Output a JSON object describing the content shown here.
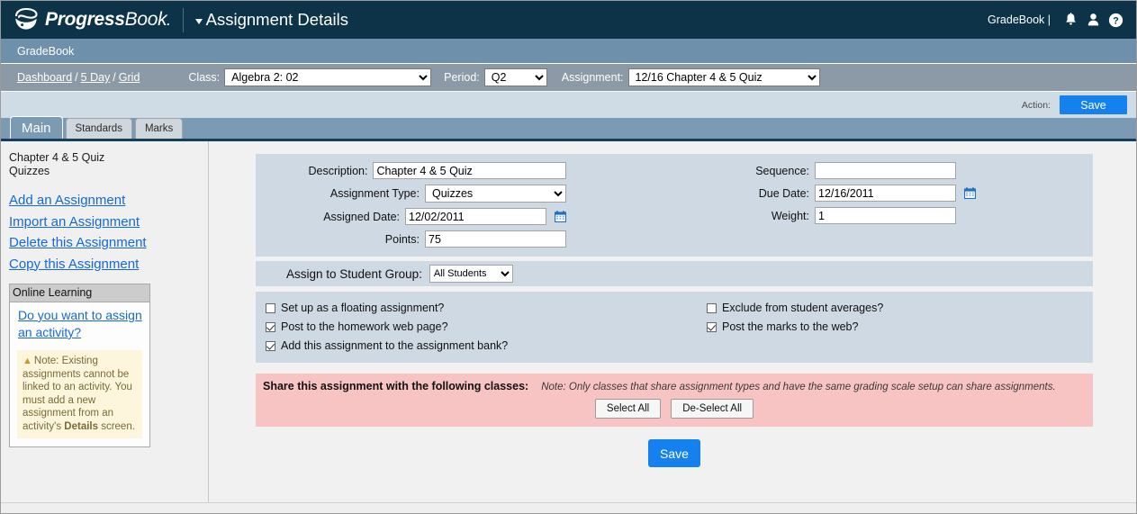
{
  "header": {
    "brand_primary": "Progress",
    "brand_secondary": "Book",
    "brand_dot": ".",
    "page_title": "Assignment Details",
    "user_label": "GradeBook |",
    "icons": {
      "notifications": "bell-icon",
      "account": "user-icon",
      "help": "help-icon"
    },
    "colors": {
      "topbar": "#0d3349",
      "accent": "#1581ef"
    }
  },
  "module_strip": {
    "label": "GradeBook"
  },
  "filter_bar": {
    "breadcrumbs": [
      {
        "label": "Dashboard"
      },
      {
        "label": "5 Day"
      },
      {
        "label": "Grid"
      }
    ],
    "breadcrumb_separator": "/",
    "class": {
      "label": "Class:",
      "value": "Algebra 2: 02"
    },
    "period": {
      "label": "Period:",
      "value": "Q2"
    },
    "assignment": {
      "label": "Assignment:",
      "value": "12/16 Chapter 4 & 5 Quiz"
    }
  },
  "action_bar": {
    "label": "Action:",
    "save_label": "Save"
  },
  "tabs": [
    {
      "label": "Main",
      "active": true
    },
    {
      "label": "Standards",
      "active": false
    },
    {
      "label": "Marks",
      "active": false
    }
  ],
  "sidebar": {
    "assignment_name": "Chapter 4 & 5 Quiz",
    "assignment_type": "Quizzes",
    "links": [
      {
        "label": "Add an Assignment"
      },
      {
        "label": "Import an Assignment"
      },
      {
        "label": "Delete this Assignment"
      },
      {
        "label": "Copy this Assignment"
      }
    ],
    "online_learning": {
      "header": "Online Learning",
      "link": "Do you want to assign an activity?",
      "note_prefix": "Note: Existing assignments cannot be linked to an activity. You must add a new assignment from an activity's ",
      "note_bold": "Details",
      "note_suffix": " screen."
    }
  },
  "form": {
    "description": {
      "label": "Description:",
      "value": "Chapter 4 & 5 Quiz"
    },
    "assignment_type": {
      "label": "Assignment Type:",
      "value": "Quizzes"
    },
    "assigned_date": {
      "label": "Assigned Date:",
      "value": "12/02/2011"
    },
    "points": {
      "label": "Points:",
      "value": "75"
    },
    "sequence": {
      "label": "Sequence:",
      "value": "",
      "placeholder": ""
    },
    "due_date": {
      "label": "Due Date:",
      "value": "12/16/2011"
    },
    "weight": {
      "label": "Weight:",
      "value": "1"
    },
    "calendar_icon": "calendar-icon"
  },
  "student_group": {
    "label": "Assign to Student Group:",
    "value": "All Students"
  },
  "checkboxes": {
    "left": [
      {
        "label": "Set up as a floating assignment?",
        "checked": false
      },
      {
        "label": "Post to the homework web page?",
        "checked": true
      },
      {
        "label": "Add this assignment to the assignment bank?",
        "checked": true
      }
    ],
    "right": [
      {
        "label": "Exclude from student averages?",
        "checked": false
      },
      {
        "label": "Post the marks to the web?",
        "checked": true
      }
    ]
  },
  "share": {
    "title": "Share this assignment with the following classes:",
    "note": "Note: Only classes that share assignment types and have the same grading scale setup can share assignments.",
    "select_all": "Select All",
    "deselect_all": "De-Select All",
    "background": "#f7c3c3"
  },
  "footer_save": {
    "label": "Save"
  }
}
